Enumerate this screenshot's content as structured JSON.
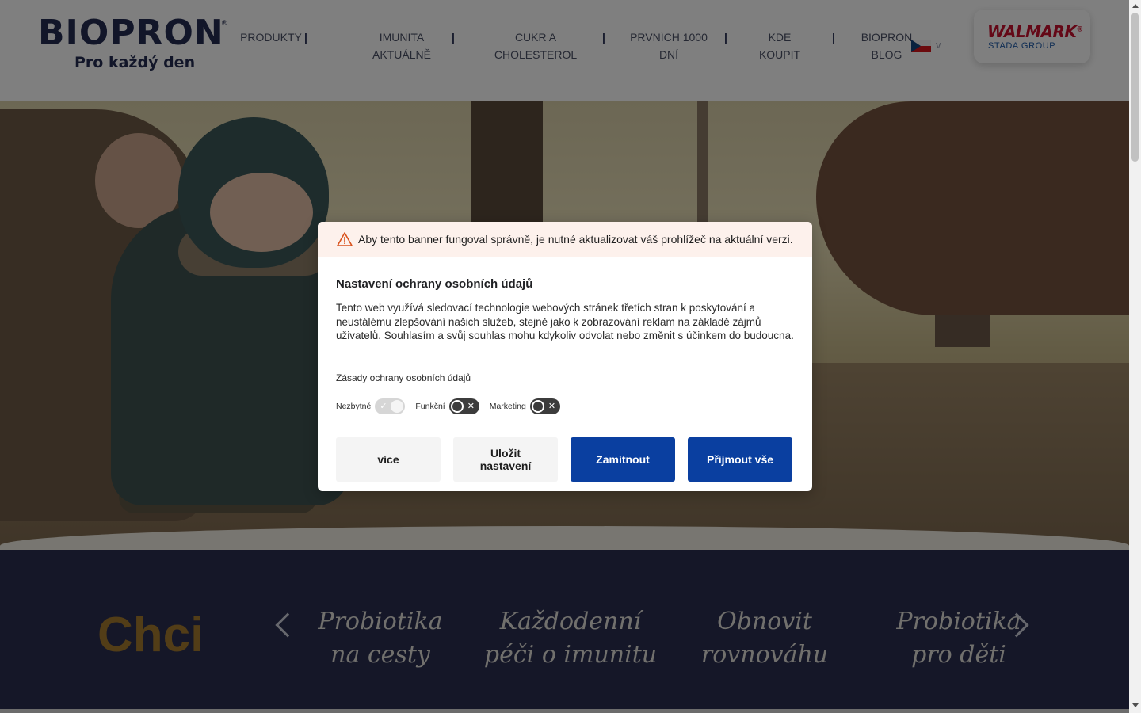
{
  "header": {
    "logo": {
      "word": "BIOPRON",
      "reg": "®",
      "tagline": "Pro každý den"
    },
    "nav": [
      {
        "line1": "PRODUKTY",
        "line2": ""
      },
      {
        "line1": "IMUNITA",
        "line2": "AKTUÁLNĚ"
      },
      {
        "line1": "CUKR A",
        "line2": "CHOLESTEROL"
      },
      {
        "line1": "PRVNÍCH 1000",
        "line2": "DNÍ"
      },
      {
        "line1": "KDE",
        "line2": "KOUPIT"
      },
      {
        "line1": "BIOPRON",
        "line2": "BLOG"
      }
    ],
    "nav_separator": "|",
    "language": {
      "flag": "czech-flag",
      "chevron": "v"
    },
    "brand": {
      "name": "WALMARK",
      "reg": "®",
      "group": "STADA GROUP"
    }
  },
  "band": {
    "heading": "Chci",
    "slides": [
      {
        "line1": "Probiotika",
        "line2": "na cesty"
      },
      {
        "line1": "Každodenní",
        "line2": "péči o imunitu"
      },
      {
        "line1": "Obnovit",
        "line2": "rovnováhu"
      },
      {
        "line1": "Probiotika",
        "line2": "pro děti"
      }
    ]
  },
  "cookie_banner": {
    "warning": "Aby tento banner fungoval správně, je nutné aktualizovat váš prohlížeč na aktuální verzi.",
    "title": "Nastavení ochrany osobních údajů",
    "description": "Tento web využívá sledovací technologie webových stránek třetích stran k poskytování a neustálému zlepšování našich služeb, stejně jako k zobrazování reklam na základě zájmů uživatelů. Souhlasím a svůj souhlas mohu kdykoliv odvolat nebo změnit s účinkem do budoucna.",
    "policy_link": "Zásady ochrany osobních údajů",
    "toggles": [
      {
        "label": "Nezbytné",
        "state": "on-disabled",
        "mark": "✓"
      },
      {
        "label": "Funkční",
        "state": "off",
        "mark": "✕"
      },
      {
        "label": "Marketing",
        "state": "off",
        "mark": "✕"
      }
    ],
    "buttons": {
      "more": "více",
      "save": "Uložit nastavení",
      "reject": "Zamítnout",
      "accept": "Přijmout vše"
    }
  },
  "colors": {
    "brand_navy": "#252d52",
    "band_bg": "#2a2f50",
    "chci_gold": "#a57a2f",
    "button_blue": "#0a3fa0",
    "warning_bg": "#fdf1ec",
    "walmark_red": "#c8102e"
  }
}
